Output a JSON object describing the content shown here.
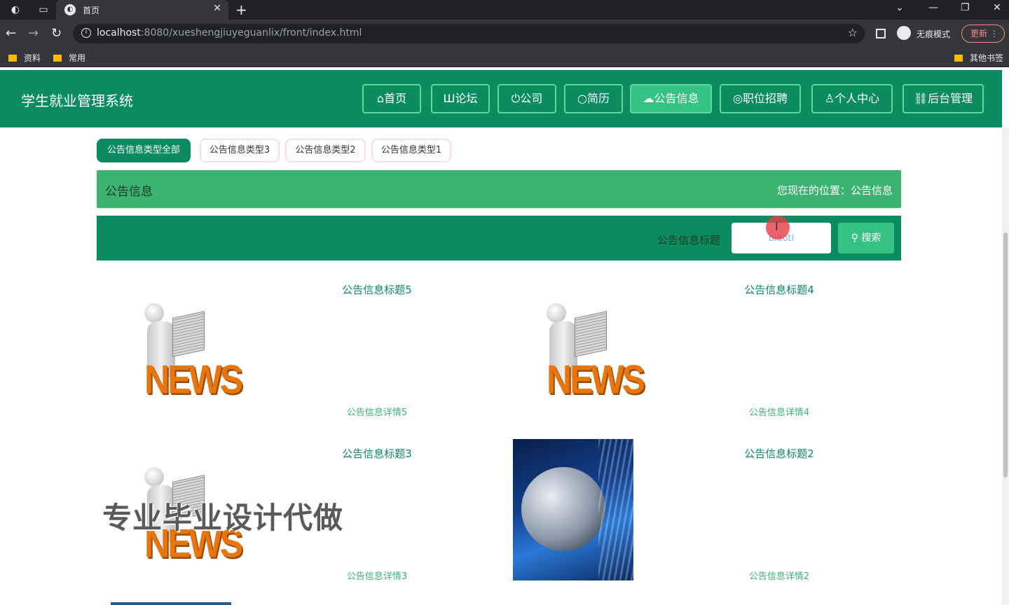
{
  "browser": {
    "tab_title": "首页",
    "url_host": "localhost",
    "url_rest": ":8080/xueshengjiuyeguanlix/front/index.html",
    "incognito_label": "无痕模式",
    "update_label": "更新",
    "bookmarks": [
      "资料",
      "常用"
    ],
    "other_bookmarks": "其他书签"
  },
  "site": {
    "title": "学生就业管理系统",
    "nav": [
      {
        "label": "首页",
        "icon": "home-icon",
        "glyph": "⌂",
        "active": false
      },
      {
        "label": "论坛",
        "icon": "forum-icon",
        "glyph": "Ш",
        "active": false
      },
      {
        "label": "公司",
        "icon": "power-icon",
        "glyph": "⏻",
        "active": false
      },
      {
        "label": "简历",
        "icon": "circle-icon",
        "glyph": "○",
        "active": false
      },
      {
        "label": "公告信息",
        "icon": "cloud-icon",
        "glyph": "☁",
        "active": true
      },
      {
        "label": "职位招聘",
        "icon": "palette-icon",
        "glyph": "◎",
        "active": false
      },
      {
        "label": "个人中心",
        "icon": "user-icon",
        "glyph": "♙",
        "active": false
      },
      {
        "label": "后台管理",
        "icon": "link-icon",
        "glyph": "⛓",
        "active": false
      }
    ]
  },
  "categories": [
    "公告信息类型全部",
    "公告信息类型3",
    "公告信息类型2",
    "公告信息类型1"
  ],
  "titlebar": {
    "name": "公告信息",
    "location": "您现在的位置：公告信息"
  },
  "search": {
    "label": "公告信息标题",
    "value": "biaoti",
    "button": "搜索"
  },
  "notices": [
    {
      "title": "公告信息标题5",
      "detail": "公告信息详情5",
      "image": "news"
    },
    {
      "title": "公告信息标题4",
      "detail": "公告信息详情4",
      "image": "news"
    },
    {
      "title": "公告信息标题3",
      "detail": "公告信息详情3",
      "image": "news"
    },
    {
      "title": "公告信息标题2",
      "detail": "公告信息详情2",
      "image": "globe"
    }
  ],
  "overlay_watermark": "专业毕业设计代做",
  "colors": {
    "primary": "#0a8c5f",
    "accent": "#35c283",
    "title_bar": "#3cb371"
  }
}
